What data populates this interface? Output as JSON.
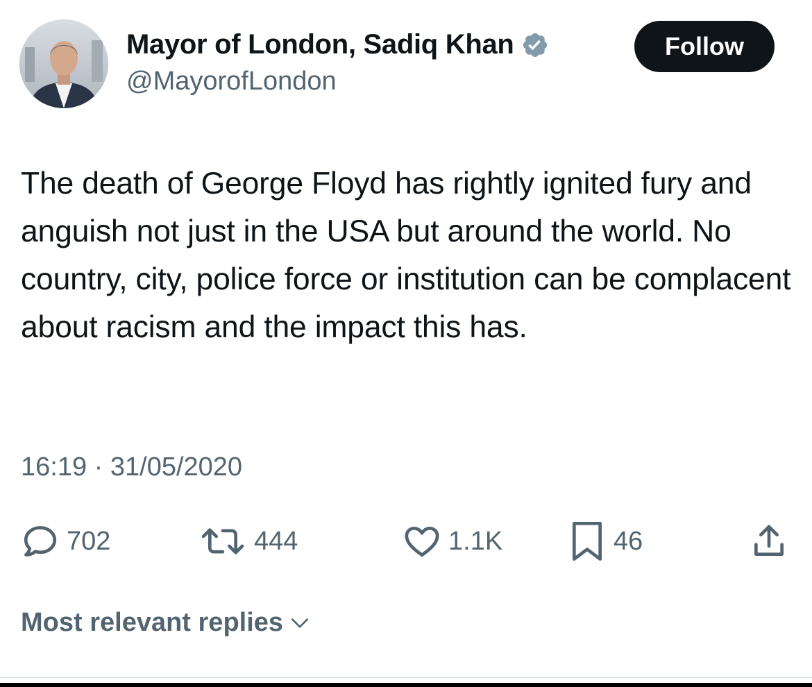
{
  "author": {
    "display_name": "Mayor of London, Sadiq Khan",
    "handle": "@MayorofLondon",
    "verified": true,
    "avatar_icon": "profile-photo"
  },
  "follow_button": {
    "label": "Follow"
  },
  "tweet": {
    "text": "The death of George Floyd has rightly ignited fury and anguish not just in the USA but around the world. No country, city, police force or institution can be complacent about racism and the impact this has.",
    "timestamp": "16:19 · 31/05/2020"
  },
  "actions": {
    "replies": {
      "icon": "reply-icon",
      "count": "702"
    },
    "reposts": {
      "icon": "repost-icon",
      "count": "444"
    },
    "likes": {
      "icon": "heart-icon",
      "count": "1.1K"
    },
    "bookmarks": {
      "icon": "bookmark-icon",
      "count": "46"
    },
    "share": {
      "icon": "share-icon"
    }
  },
  "replies_sort": {
    "label": "Most relevant replies",
    "icon": "chevron-down-icon"
  },
  "colors": {
    "text_primary": "#0f1419",
    "text_secondary": "#536471",
    "button_bg": "#0f1419",
    "button_text": "#ffffff",
    "verified_badge": "#829aab"
  }
}
